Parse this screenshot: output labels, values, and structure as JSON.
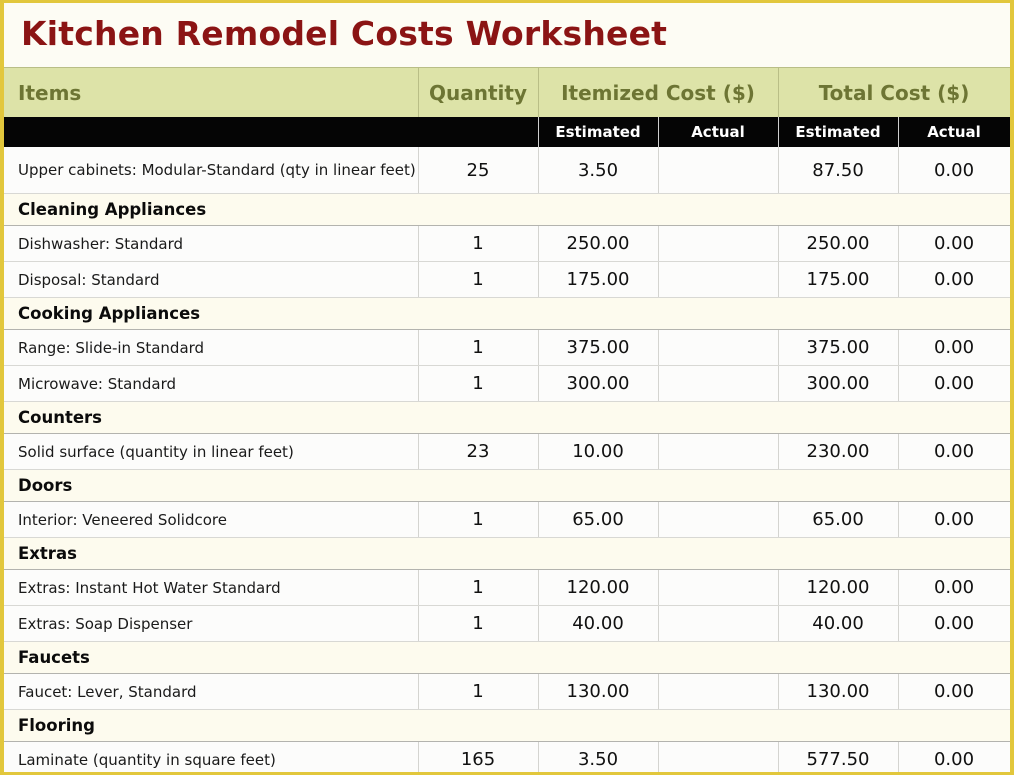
{
  "title": "Kitchen Remodel Costs Worksheet",
  "colors": {
    "title": "#8b1414",
    "frame": "#e2c73c",
    "header_bg": "#dde3a8",
    "header_text": "#6d7534",
    "subheader_bg": "#050505",
    "category_bg": "#fdfbee"
  },
  "headers": {
    "items": "Items",
    "quantity": "Quantity",
    "itemized_cost": "Itemized Cost ($)",
    "total_cost": "Total Cost ($)",
    "estimated": "Estimated",
    "actual": "Actual"
  },
  "rows": [
    {
      "type": "item",
      "name": "Upper cabinets: Modular-Standard (qty in linear feet)",
      "quantity": "25",
      "itemized_estimated": "3.50",
      "itemized_actual": "",
      "total_estimated": "87.50",
      "total_actual": "0.00"
    },
    {
      "type": "category",
      "name": "Cleaning Appliances"
    },
    {
      "type": "item",
      "name": "Dishwasher: Standard",
      "quantity": "1",
      "itemized_estimated": "250.00",
      "itemized_actual": "",
      "total_estimated": "250.00",
      "total_actual": "0.00"
    },
    {
      "type": "item",
      "name": "Disposal: Standard",
      "quantity": "1",
      "itemized_estimated": "175.00",
      "itemized_actual": "",
      "total_estimated": "175.00",
      "total_actual": "0.00"
    },
    {
      "type": "category",
      "name": "Cooking Appliances"
    },
    {
      "type": "item",
      "name": "Range: Slide-in Standard",
      "quantity": "1",
      "itemized_estimated": "375.00",
      "itemized_actual": "",
      "total_estimated": "375.00",
      "total_actual": "0.00"
    },
    {
      "type": "item",
      "name": "Microwave: Standard",
      "quantity": "1",
      "itemized_estimated": "300.00",
      "itemized_actual": "",
      "total_estimated": "300.00",
      "total_actual": "0.00"
    },
    {
      "type": "category",
      "name": "Counters"
    },
    {
      "type": "item",
      "name": "Solid surface (quantity in linear feet)",
      "quantity": "23",
      "itemized_estimated": "10.00",
      "itemized_actual": "",
      "total_estimated": "230.00",
      "total_actual": "0.00"
    },
    {
      "type": "category",
      "name": "Doors"
    },
    {
      "type": "item",
      "name": "Interior: Veneered Solidcore",
      "quantity": "1",
      "itemized_estimated": "65.00",
      "itemized_actual": "",
      "total_estimated": "65.00",
      "total_actual": "0.00"
    },
    {
      "type": "category",
      "name": "Extras"
    },
    {
      "type": "item",
      "name": "Extras: Instant Hot Water Standard",
      "quantity": "1",
      "itemized_estimated": "120.00",
      "itemized_actual": "",
      "total_estimated": "120.00",
      "total_actual": "0.00"
    },
    {
      "type": "item",
      "name": "Extras: Soap Dispenser",
      "quantity": "1",
      "itemized_estimated": "40.00",
      "itemized_actual": "",
      "total_estimated": "40.00",
      "total_actual": "0.00"
    },
    {
      "type": "category",
      "name": "Faucets"
    },
    {
      "type": "item",
      "name": "Faucet: Lever, Standard",
      "quantity": "1",
      "itemized_estimated": "130.00",
      "itemized_actual": "",
      "total_estimated": "130.00",
      "total_actual": "0.00"
    },
    {
      "type": "category",
      "name": "Flooring"
    },
    {
      "type": "item",
      "name": "Laminate (quantity in square feet)",
      "quantity": "165",
      "itemized_estimated": "3.50",
      "itemized_actual": "",
      "total_estimated": "577.50",
      "total_actual": "0.00"
    }
  ]
}
